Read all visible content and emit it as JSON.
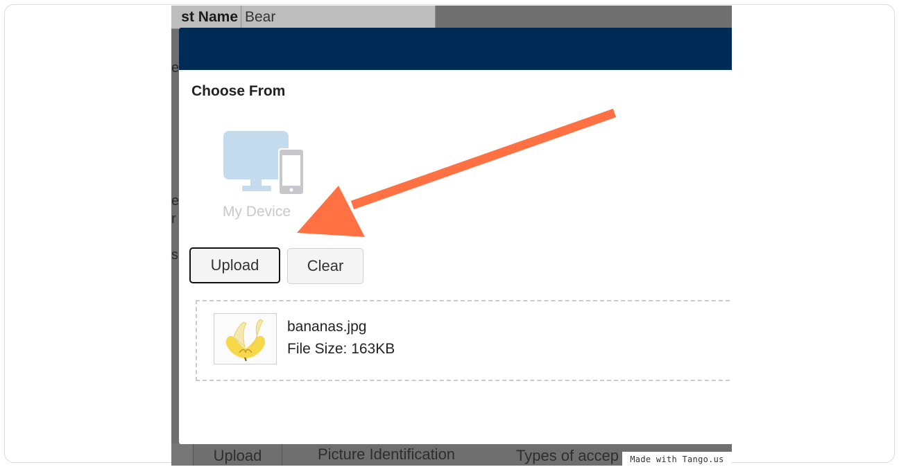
{
  "background_page": {
    "row1_label": "st Name",
    "row1_value": "Bear",
    "edge_chars": [
      "e",
      "e",
      "r",
      "s"
    ],
    "bottom_row": {
      "upload": "Upload",
      "picture_identification": "Picture Identification",
      "types": "Types of accep"
    }
  },
  "modal": {
    "section_title": "Choose From",
    "device_option_label": "My Device",
    "upload_button": "Upload",
    "clear_button": "Clear",
    "file": {
      "name": "bananas.jpg",
      "size_text": "File Size: 163KB"
    }
  },
  "watermark": "Made with Tango.us",
  "colors": {
    "modal_header": "#002b57",
    "arrow": "#ff7043",
    "device_icon": "#c5dcef"
  },
  "icons": {
    "device": "monitor-and-phone-icon",
    "arrow": "annotation-arrow-icon"
  }
}
